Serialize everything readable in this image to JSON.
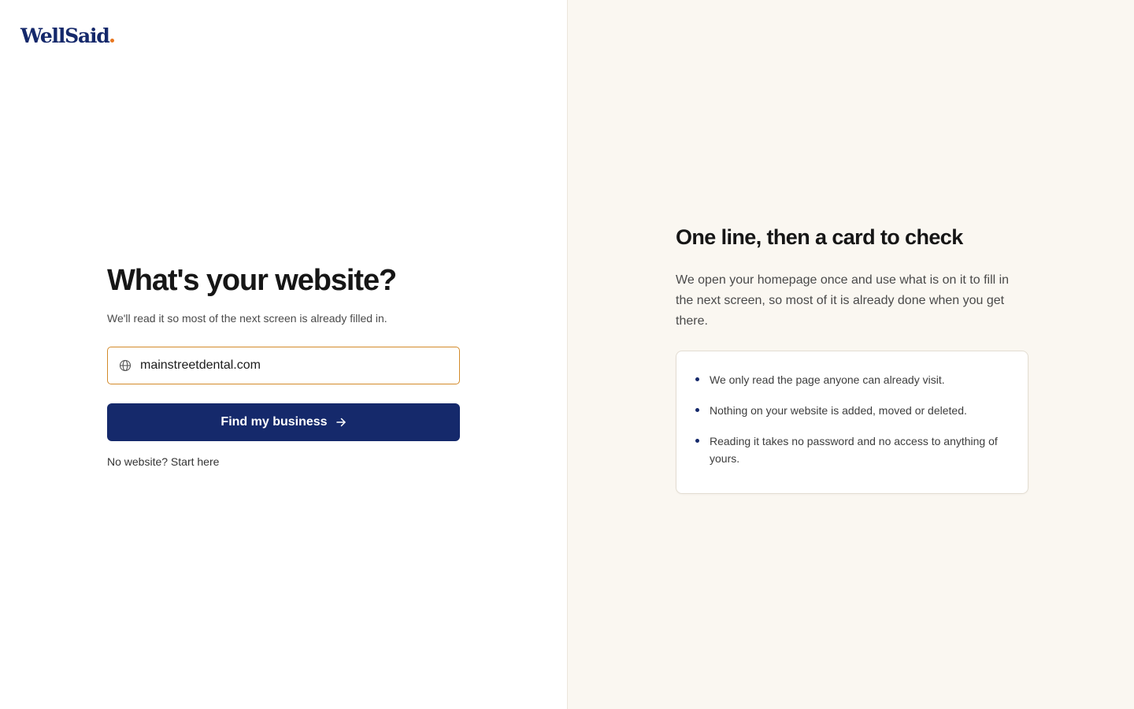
{
  "brand": {
    "name": "WellSaid",
    "accent_dot_color": "#e8761f",
    "primary_color": "#15296b"
  },
  "form": {
    "title": "What's your website?",
    "subtitle": "We'll read it so most of the next screen is already filled in.",
    "url_field": {
      "value": "mainstreetdental.com",
      "icon": "globe-icon"
    },
    "submit_label": "Find my business",
    "submit_icon": "arrow-right-icon",
    "no_website_link": "No website? Start here"
  },
  "info": {
    "title": "One line, then a card to check",
    "body": "We open your homepage once and use what is on it to fill in the next screen, so most of it is already done when you get there.",
    "points": [
      "We only read the page anyone can already visit.",
      "Nothing on your website is added, moved or deleted.",
      "Reading it takes no password and no access to anything of yours."
    ]
  }
}
